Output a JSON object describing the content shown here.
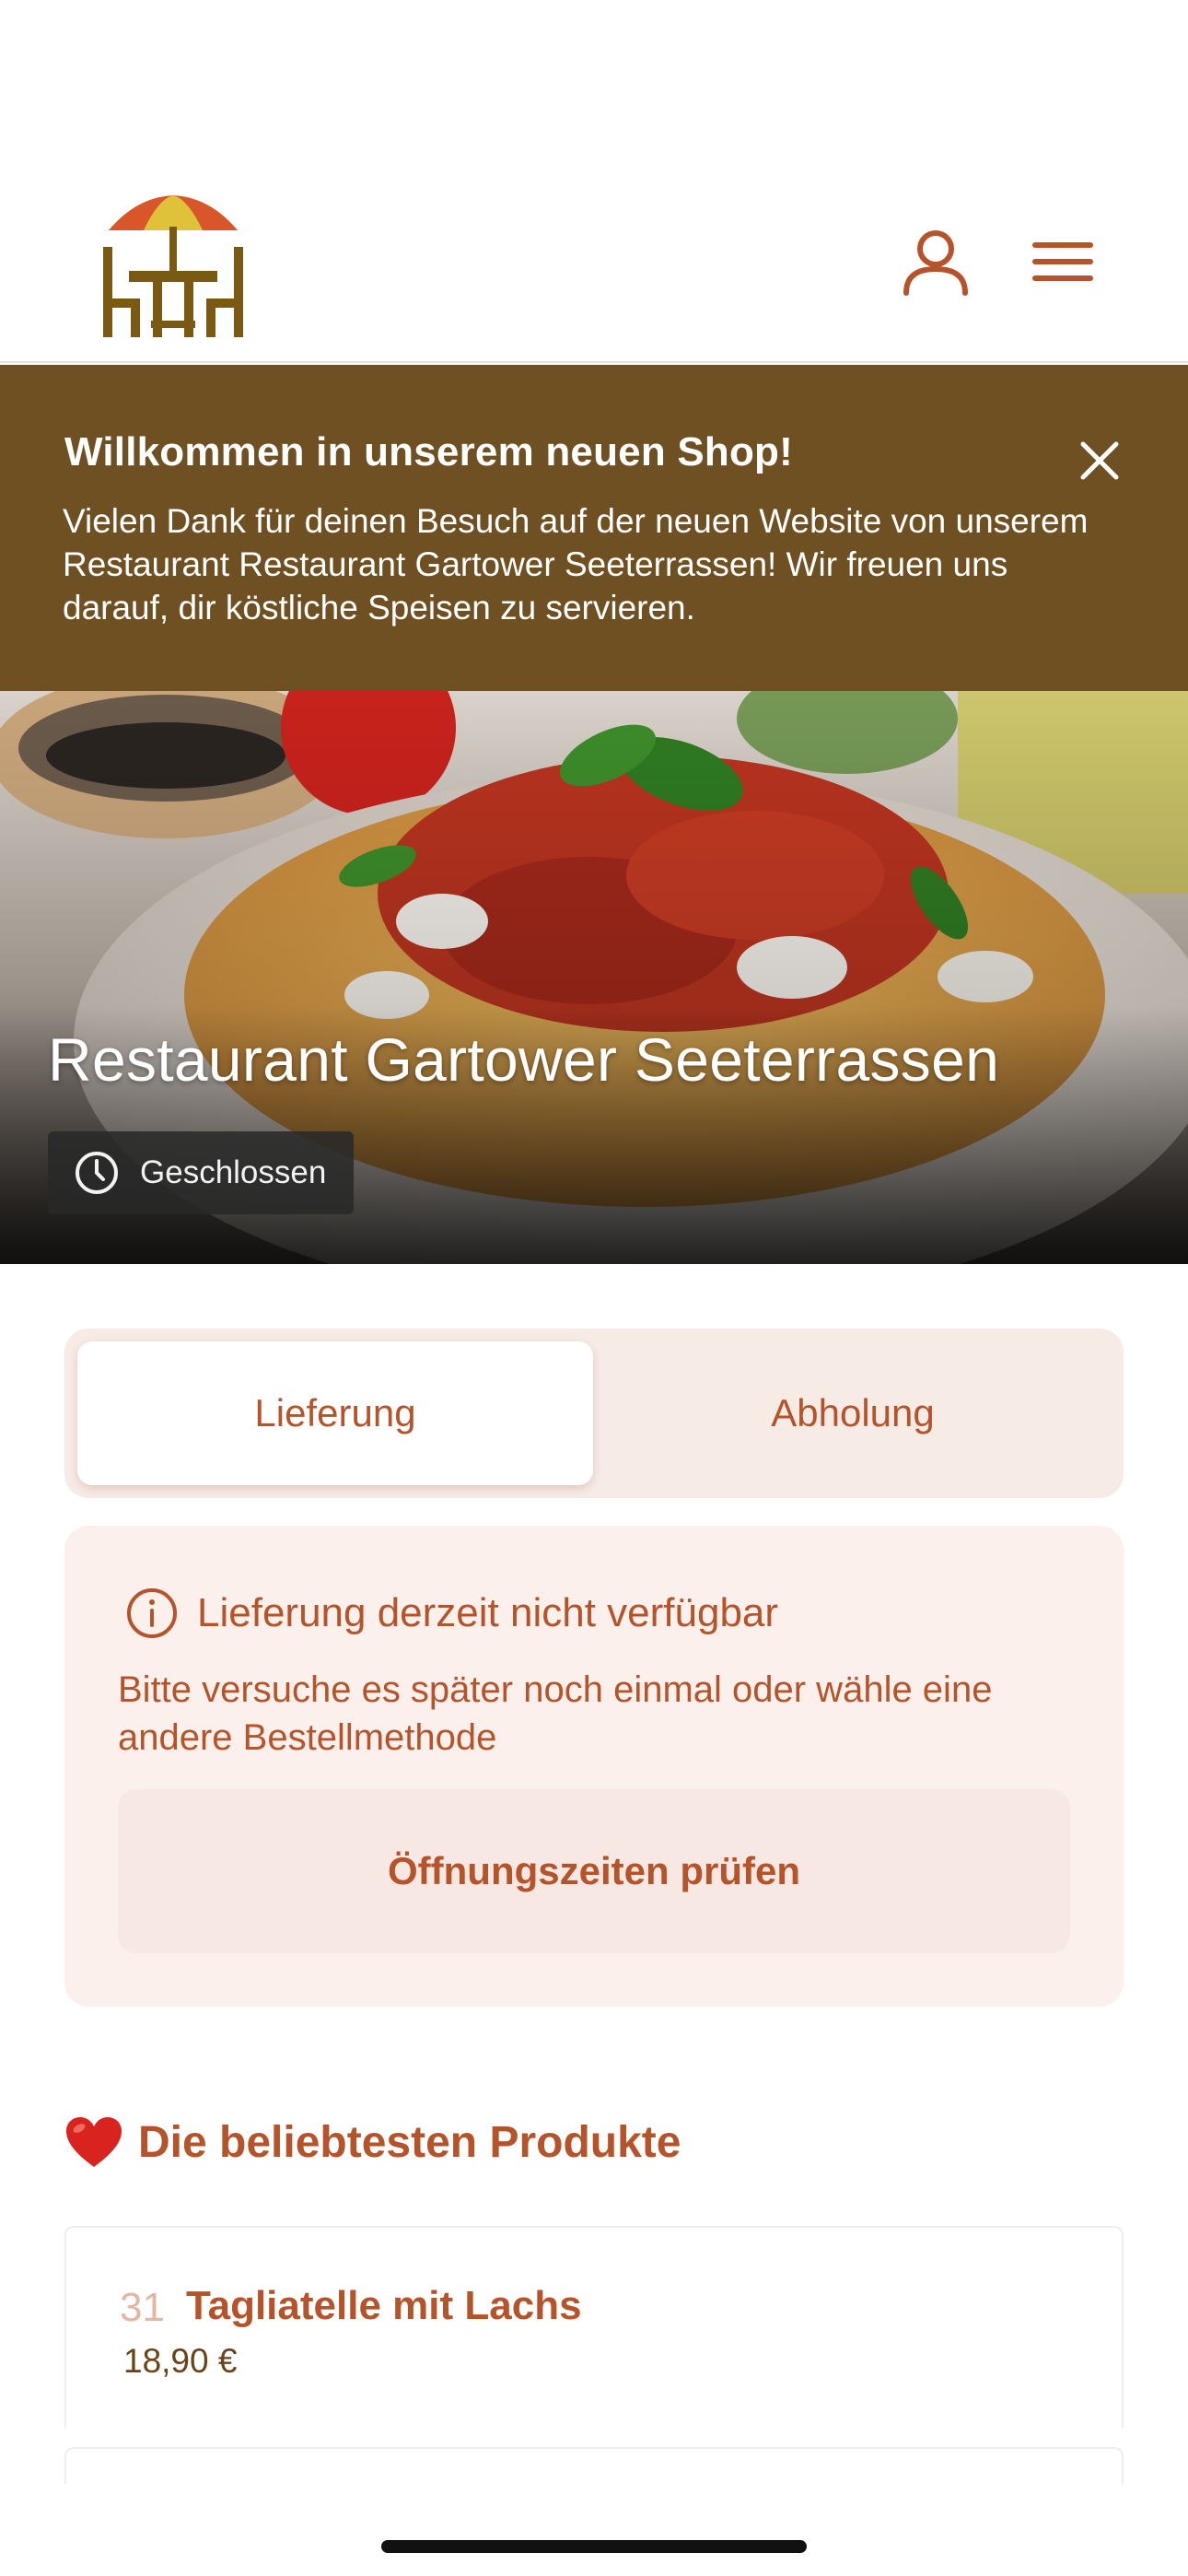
{
  "header": {
    "logo_icon": "restaurant-table-umbrella-logo",
    "user_icon": "user-icon",
    "menu_icon": "hamburger-menu-icon"
  },
  "banner": {
    "title": "Willkommen in unserem neuen Shop!",
    "text": "Vielen Dank für deinen Besuch auf der neuen Website von unserem Restaurant Restaurant Gartower Seeterrassen! Wir freuen uns darauf, dir köstliche Speisen zu servieren.",
    "close_icon": "close-icon",
    "background": "#6f5022"
  },
  "hero": {
    "title": "Restaurant Gartower Seeterrassen",
    "status": "Geschlossen",
    "status_icon": "clock-icon"
  },
  "order_tabs": {
    "delivery_label": "Lieferung",
    "pickup_label": "Abholung",
    "active": "Lieferung"
  },
  "alert": {
    "title": "Lieferung derzeit nicht verfügbar",
    "text": "Bitte versuche es später noch einmal oder wähle eine andere Bestellmethode",
    "button_label": "Öffnungszeiten prüfen",
    "icon": "info-icon"
  },
  "popular": {
    "title": "Die beliebtesten Produkte",
    "icon": "heart-icon",
    "products": [
      {
        "number": "31",
        "name": "Tagliatelle mit Lachs",
        "price": "18,90 €"
      }
    ]
  },
  "colors": {
    "accent": "#b5532b",
    "banner": "#6f5022",
    "tab_bg": "#f7ebe6",
    "alert_bg": "#fcf0ec"
  }
}
